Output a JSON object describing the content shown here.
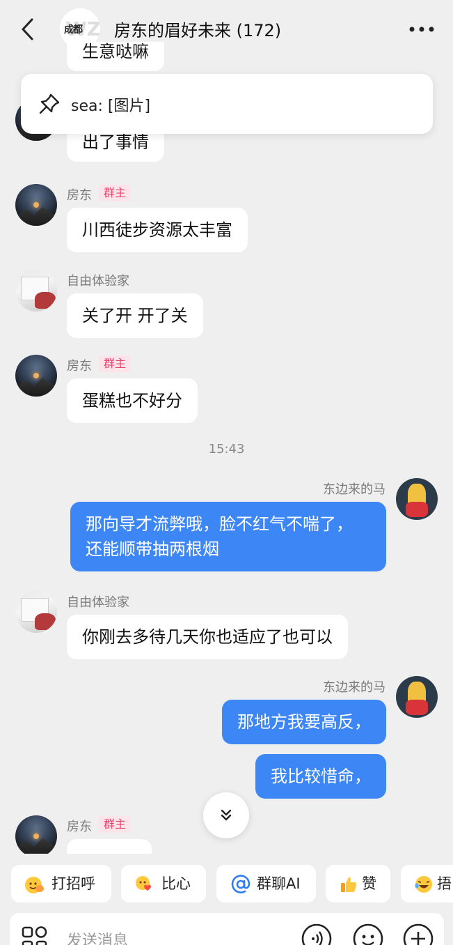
{
  "header": {
    "title": "房东的眉好未来 (172)",
    "group_logo_text": "成都",
    "back_icon": "chevron-left-icon",
    "more_icon": "more-dots-icon"
  },
  "pinned": {
    "text": "sea: [图片]",
    "icon": "pin-icon"
  },
  "messages": {
    "m0": {
      "text": "生意哒嘛"
    },
    "m1": {
      "text": "出了事情"
    },
    "m2": {
      "sender": "房东",
      "badge": "群主",
      "text": "川西徒步资源太丰富"
    },
    "m3": {
      "sender": "自由体验家",
      "text": "关了开 开了关"
    },
    "m4": {
      "sender": "房东",
      "badge": "群主",
      "text": "蛋糕也不好分"
    },
    "time": "15:43",
    "m5": {
      "sender": "东边来的马",
      "line1": "那向导才流弊哦，脸不红气不喘了，",
      "line2": "还能顺带抽两根烟"
    },
    "m6": {
      "sender": "自由体验家",
      "text": "你刚去多待几天你也适应了也可以"
    },
    "m7": {
      "sender": "东边来的马",
      "text": "那地方我要高反，"
    },
    "m8": {
      "text": "我比较惜命，"
    },
    "m9": {
      "sender": "房东",
      "badge": "群主"
    }
  },
  "quick_actions": [
    {
      "label": "打招呼",
      "icon": "wave-emoji-icon"
    },
    {
      "label": "比心",
      "icon": "heart-hand-emoji-icon"
    },
    {
      "label": "群聊AI",
      "icon": "at-icon"
    },
    {
      "label": "赞",
      "icon": "thumbs-up-icon"
    },
    {
      "label": "捂",
      "icon": "laugh-cry-emoji-icon"
    }
  ],
  "input": {
    "placeholder": "发送消息",
    "icons": [
      "apps-grid-icon",
      "voice-icon",
      "emoji-icon",
      "plus-icon"
    ]
  },
  "colors": {
    "background": "#efefef",
    "my_bubble": "#3d86f5",
    "owner_badge_text": "#e6426a",
    "owner_badge_bg": "#fbe4ea"
  }
}
